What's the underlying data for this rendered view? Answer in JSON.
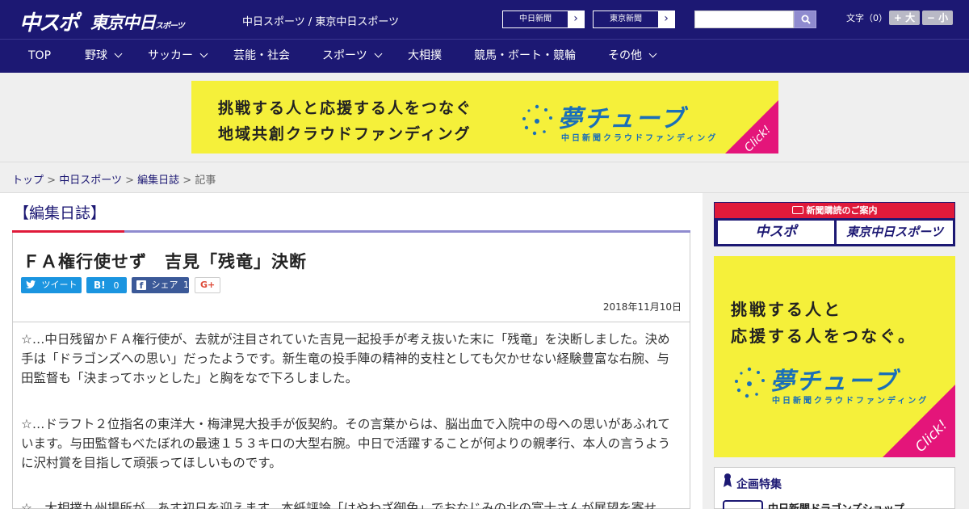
{
  "header": {
    "logo_chu": "中スポ",
    "logo_tokyo": "東京中日",
    "logo_tokyo_small": "スポーツ",
    "site_name": "中日スポーツ / 東京中日スポーツ",
    "paper_links": [
      {
        "label": "中日新聞",
        "arrow": "›"
      },
      {
        "label": "東京新聞",
        "arrow": "›"
      }
    ],
    "search_placeholder": "",
    "font_size_label": "文字（0）",
    "font_larger": "+ 大",
    "font_smaller": "− 小"
  },
  "nav": {
    "items": [
      {
        "label": "TOP",
        "has_menu": false
      },
      {
        "label": "野球",
        "has_menu": true
      },
      {
        "label": "サッカー",
        "has_menu": true
      },
      {
        "label": "芸能・社会",
        "has_menu": false
      },
      {
        "label": "スポーツ",
        "has_menu": true
      },
      {
        "label": "大相撲",
        "has_menu": false
      },
      {
        "label": "競馬・ボート・競輪",
        "has_menu": false
      },
      {
        "label": "その他",
        "has_menu": true
      }
    ]
  },
  "banner": {
    "line1": "挑戦する人と応援する人をつなぐ",
    "line2": "地域共創クラウドファンディング",
    "brand": "夢チューブ",
    "brand_sub": "中日新聞クラウドファンディング",
    "click": "Click!"
  },
  "breadcrumb": {
    "items": [
      "トップ",
      "中日スポーツ",
      "編集日誌"
    ],
    "separator": ">",
    "current": "記事"
  },
  "article": {
    "section": "【編集日誌】",
    "title": "ＦＡ権行使せず　吉見「残竜」決断",
    "share": {
      "tweet": "ツイート",
      "hatena_icon": "B!",
      "hatena_count": "0",
      "fb_icon": "f",
      "fb_label": "シェア",
      "fb_count": "1",
      "gplus": "G+"
    },
    "date": "2018年11月10日",
    "paragraphs": [
      "☆…中日残留かＦＡ権行使が、去就が注目されていた吉見一起投手が考え抜いた末に「残竜」を決断しました。決め手は「ドラゴンズへの思い」だったようです。新生竜の投手陣の精神的支柱としても欠かせない経験豊富な右腕、与田監督も「決まってホッとした」と胸をなで下ろしました。",
      "☆…ドラフト２位指名の東洋大・梅津晃大投手が仮契約。その言葉からは、脳出血で入院中の母への思いがあふれています。与田監督もべたぼれの最速１５３キロの大型右腕。中日で活躍することが何よりの親孝行、本人の言うように沢村賞を目指して頑張ってほしいものです。",
      "☆…大相撲九州場所が、あす初日を迎えます。本紙評論「はやわざ御免」でおなじみの北の富士さんが展望を寄せ"
    ]
  },
  "sidebar": {
    "subscribe_head": "新聞購読のご案内",
    "subscribe_logos": [
      "中スポ",
      "東京中日スポーツ"
    ],
    "banner_line1": "挑戦する人と",
    "banner_line2": "応援する人をつなぐ。",
    "banner_brand": "夢チューブ",
    "banner_brand_sub": "中日新聞クラウドファンディング",
    "banner_click": "Click!",
    "feature_head": "企画特集",
    "feature_item": "中日新聞ドラゴンズショップ"
  },
  "colors": {
    "brand_navy": "#1c1873",
    "accent_red": "#e01a3a",
    "banner_yellow": "#f5f03a",
    "banner_pink": "#e4157a"
  }
}
